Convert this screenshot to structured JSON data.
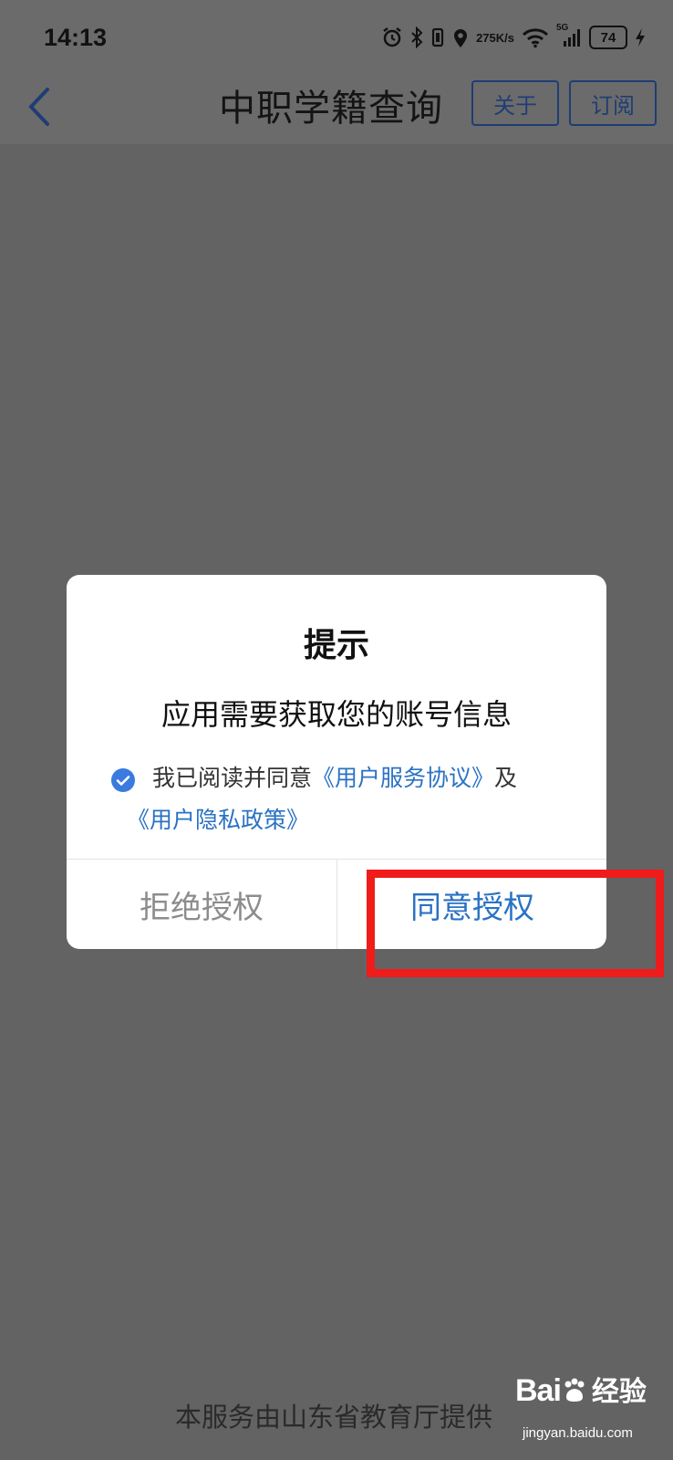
{
  "status_bar": {
    "time": "14:13",
    "net_speed_value": "275",
    "net_speed_unit": "K/s",
    "signal_label": "5G",
    "battery": "74"
  },
  "nav": {
    "title": "中职学籍查询",
    "about_label": "关于",
    "subscribe_label": "订阅"
  },
  "dialog": {
    "title": "提示",
    "message": "应用需要获取您的账号信息",
    "agree_prefix": "我已阅读并同意",
    "user_agreement_link": "《用户服务协议》",
    "conjunction": "及",
    "privacy_policy_link": "《用户隐私政策》",
    "reject_label": "拒绝授权",
    "accept_label": "同意授权",
    "checkbox_checked": true
  },
  "footer": {
    "provider_text": "本服务由山东省教育厅提供"
  },
  "watermark": {
    "logo_text": "Bai",
    "logo_suffix": "经验",
    "url": "jingyan.baidu.com"
  },
  "colors": {
    "accent": "#2a72c4",
    "highlight": "#f01b1b",
    "overlay": "#636363"
  }
}
